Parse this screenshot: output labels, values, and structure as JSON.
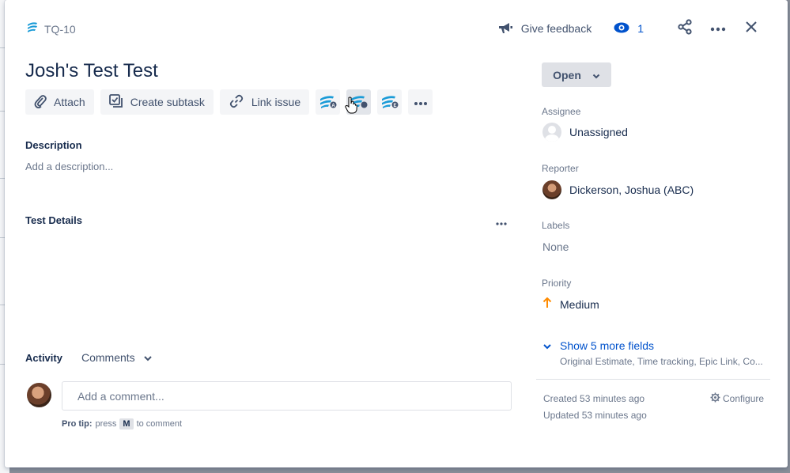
{
  "issue": {
    "key": "TQ-10",
    "title": "Josh's Test Test"
  },
  "header": {
    "feedback_label": "Give feedback",
    "watch_count": "1"
  },
  "toolbar": {
    "attach_label": "Attach",
    "subtask_label": "Create subtask",
    "link_label": "Link issue"
  },
  "description": {
    "label": "Description",
    "placeholder": "Add a description..."
  },
  "test_details": {
    "label": "Test Details"
  },
  "activity": {
    "label": "Activity",
    "filter": "Comments",
    "comment_placeholder": "Add a comment...",
    "protip_prefix": "Pro tip:",
    "protip_press": "press",
    "protip_key": "M",
    "protip_suffix": "to comment"
  },
  "status": {
    "label": "Open"
  },
  "fields": {
    "assignee_label": "Assignee",
    "assignee_value": "Unassigned",
    "reporter_label": "Reporter",
    "reporter_value": "Dickerson, Joshua (ABC)",
    "labels_label": "Labels",
    "labels_value": "None",
    "priority_label": "Priority",
    "priority_value": "Medium"
  },
  "more_fields": {
    "link": "Show 5 more fields",
    "summary": "Original Estimate, Time tracking, Epic Link, Co..."
  },
  "meta": {
    "created": "Created 53 minutes ago",
    "updated": "Updated 53 minutes ago",
    "configure": "Configure"
  },
  "colors": {
    "primary": "#0052cc",
    "text": "#172b4d",
    "muted": "#6b778c",
    "subtle_bg": "#f4f5f7",
    "priority_medium": "#ff8b00",
    "brand_xray": "#1a9bd7"
  }
}
